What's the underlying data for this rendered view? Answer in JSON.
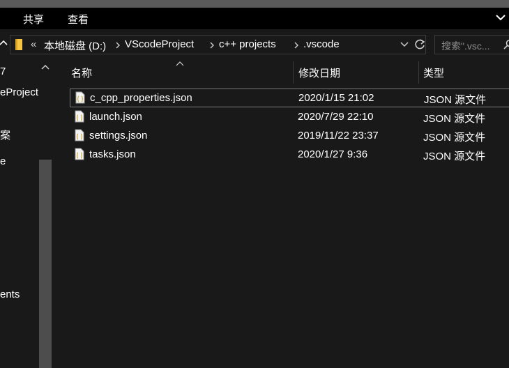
{
  "ribbon": {
    "tabs": [
      "共享",
      "查看"
    ],
    "expand_icon": "chevron-down-icon"
  },
  "address": {
    "overflow": "«",
    "crumbs": [
      "本地磁盘 (D:)",
      "VScodeProject",
      "c++ projects",
      ".vscode"
    ],
    "folder_icon_color": "#f6c644"
  },
  "search": {
    "placeholder": "搜索\".vsc..."
  },
  "nav_pane": {
    "items": [
      "7",
      "eProject",
      "案",
      "e",
      "ents"
    ]
  },
  "columns": {
    "name": "名称",
    "date": "修改日期",
    "type": "类型"
  },
  "files": [
    {
      "name": "c_cpp_properties.json",
      "date": "2020/1/15 21:02",
      "type": "JSON 源文件"
    },
    {
      "name": "launch.json",
      "date": "2020/7/29 22:10",
      "type": "JSON 源文件"
    },
    {
      "name": "settings.json",
      "date": "2019/11/22 23:37",
      "type": "JSON 源文件"
    },
    {
      "name": "tasks.json",
      "date": "2020/1/27 9:36",
      "type": "JSON 源文件"
    }
  ],
  "colors": {
    "background": "#191919",
    "ribbon": "#000000",
    "border": "#3c3c3c",
    "accent": "#f6c644"
  }
}
